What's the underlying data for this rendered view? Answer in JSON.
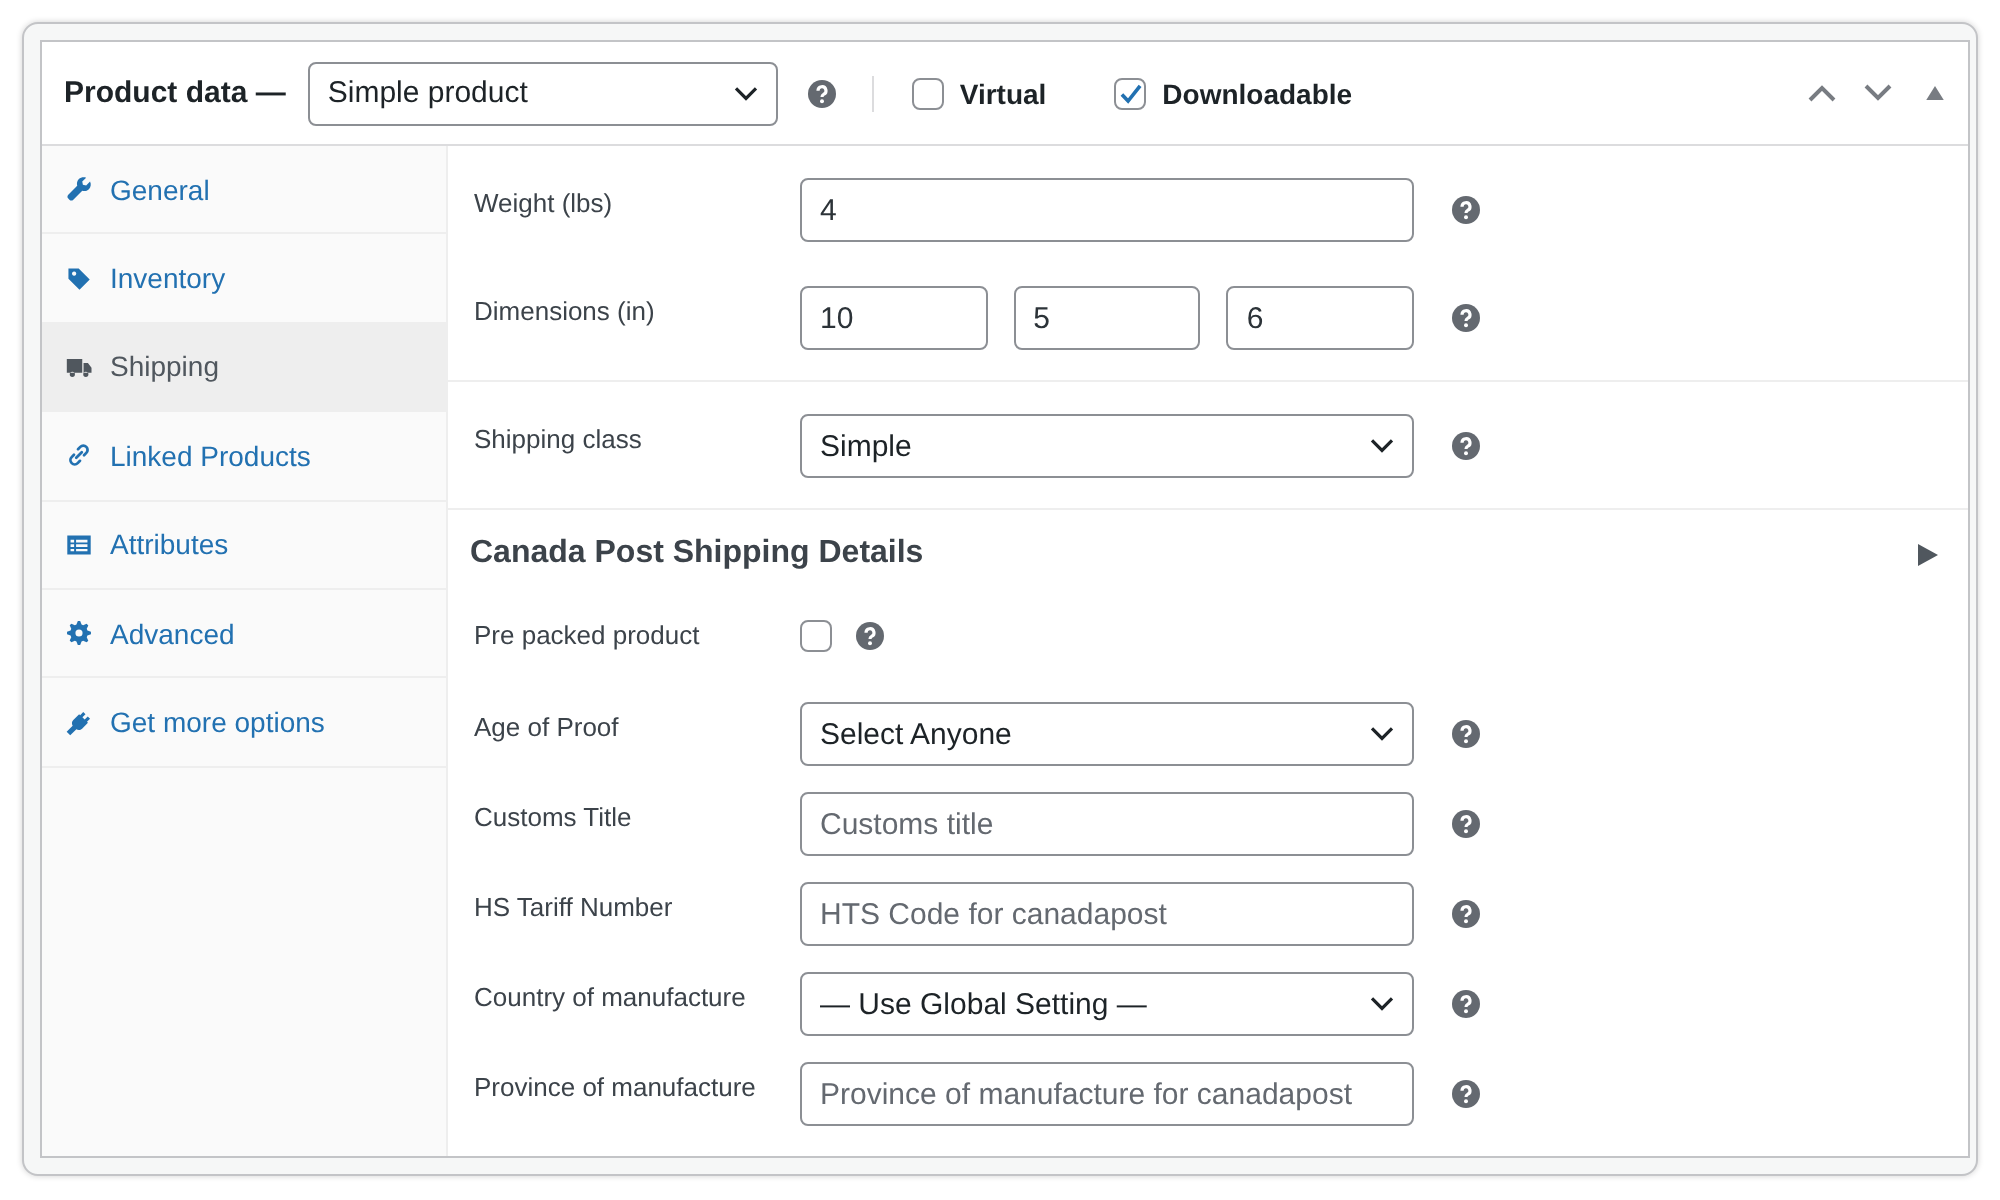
{
  "panel": {
    "title": "Product data —",
    "product_type": "Simple product",
    "options": [
      {
        "label": "Virtual",
        "checked": false
      },
      {
        "label": "Downloadable",
        "checked": true
      }
    ]
  },
  "tabs": [
    {
      "label": "General",
      "selected": false
    },
    {
      "label": "Inventory",
      "selected": false
    },
    {
      "label": "Shipping",
      "selected": true
    },
    {
      "label": "Linked Products",
      "selected": false
    },
    {
      "label": "Attributes",
      "selected": false
    },
    {
      "label": "Advanced",
      "selected": false
    },
    {
      "label": "Get more options",
      "selected": false
    }
  ],
  "shipping": {
    "sections": [
      {
        "rows": [
          {
            "kind": "text",
            "label": "Weight (lbs)",
            "inputs": [
              {
                "value": "4"
              }
            ]
          },
          {
            "kind": "text",
            "label": "Dimensions (in)",
            "inputs": [
              {
                "value": "10"
              },
              {
                "value": "5"
              },
              {
                "value": "6"
              }
            ]
          }
        ]
      },
      {
        "rows": [
          {
            "kind": "select",
            "label": "Shipping class",
            "value": "Simple"
          }
        ]
      },
      {
        "title": "Canada Post Shipping Details",
        "rows": [
          {
            "kind": "checkbox",
            "label": "Pre packed product",
            "checked": false
          },
          {
            "kind": "select",
            "label": "Age of Proof",
            "value": "Select Anyone"
          },
          {
            "kind": "text",
            "label": "Customs Title",
            "inputs": [
              {
                "placeholder": "Customs title"
              }
            ]
          },
          {
            "kind": "text",
            "label": "HS Tariff Number",
            "inputs": [
              {
                "placeholder": "HTS Code for canadapost"
              }
            ]
          },
          {
            "kind": "select",
            "label": "Country of manufacture",
            "value": "— Use Global Setting —"
          },
          {
            "kind": "text",
            "label": "Province of manufacture",
            "inputs": [
              {
                "placeholder": "Province of manufacture for canadapost"
              }
            ]
          }
        ]
      }
    ]
  }
}
